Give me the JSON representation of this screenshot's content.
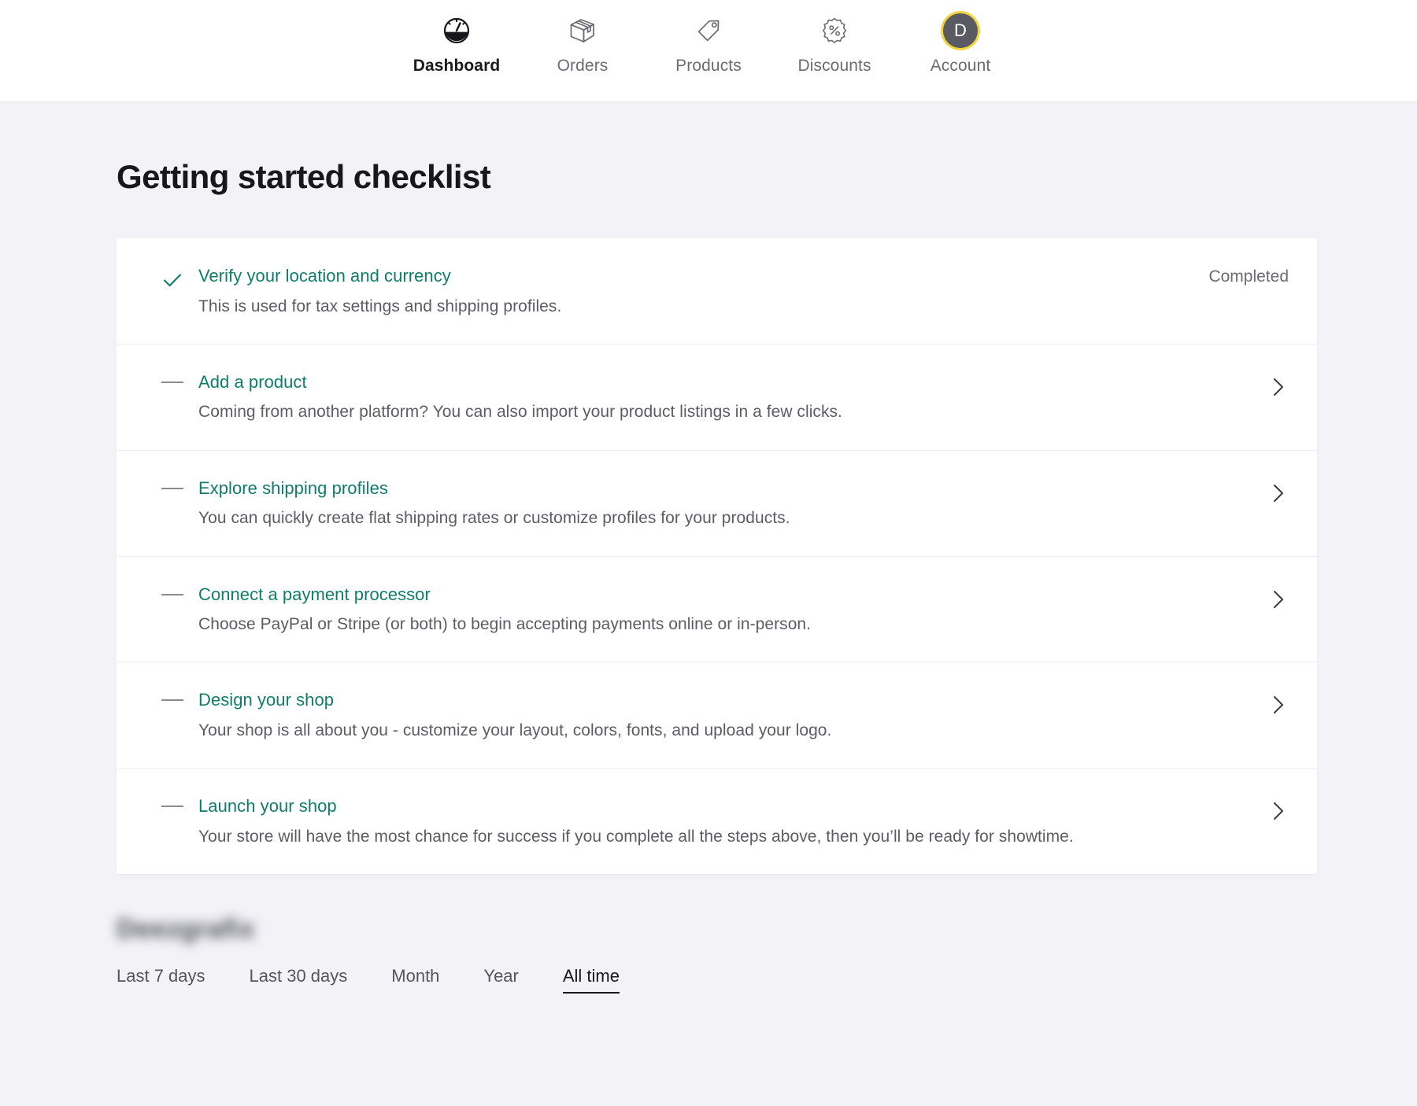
{
  "nav": {
    "items": [
      {
        "label": "Dashboard",
        "icon": "speedometer-icon",
        "active": true
      },
      {
        "label": "Orders",
        "icon": "box-icon",
        "active": false
      },
      {
        "label": "Products",
        "icon": "tag-icon",
        "active": false
      },
      {
        "label": "Discounts",
        "icon": "percent-badge-icon",
        "active": false
      },
      {
        "label": "Account",
        "icon": "avatar-icon",
        "active": false,
        "avatar_initial": "D"
      }
    ]
  },
  "page": {
    "title": "Getting started checklist"
  },
  "checklist": {
    "items": [
      {
        "title": "Verify your location and currency",
        "description": "This is used for tax settings and shipping profiles.",
        "status": "completed",
        "status_label": "Completed",
        "marker": "check-icon",
        "action": "none"
      },
      {
        "title": "Add a product",
        "description": "Coming from another platform? You can also import your product listings in a few clicks.",
        "status": "incomplete",
        "status_label": "",
        "marker": "dash-icon",
        "action": "chevron-right-icon"
      },
      {
        "title": "Explore shipping profiles",
        "description": "You can quickly create flat shipping rates or customize profiles for your products.",
        "status": "incomplete",
        "status_label": "",
        "marker": "dash-icon",
        "action": "chevron-right-icon"
      },
      {
        "title": "Connect a payment processor",
        "description": "Choose PayPal or Stripe (or both) to begin accepting payments online or in-person.",
        "status": "incomplete",
        "status_label": "",
        "marker": "dash-icon",
        "action": "chevron-right-icon"
      },
      {
        "title": "Design your shop",
        "description": "Your shop is all about you - customize your layout, colors, fonts, and upload your logo.",
        "status": "incomplete",
        "status_label": "",
        "marker": "dash-icon",
        "action": "chevron-right-icon"
      },
      {
        "title": "Launch your shop",
        "description": "Your store will have the most chance for success if you complete all the steps above, then you’ll be ready for showtime.",
        "status": "incomplete",
        "status_label": "",
        "marker": "dash-icon",
        "action": "chevron-right-icon"
      }
    ]
  },
  "stats": {
    "shop_name": "Deezgrafix",
    "range_tabs": [
      {
        "label": "Last 7 days",
        "active": false
      },
      {
        "label": "Last 30 days",
        "active": false
      },
      {
        "label": "Month",
        "active": false
      },
      {
        "label": "Year",
        "active": false
      },
      {
        "label": "All time",
        "active": true
      }
    ]
  },
  "colors": {
    "accent_teal": "#0f7d6b",
    "page_background": "#f2f2f7",
    "card_background": "#ffffff",
    "avatar_ring": "#f2d43c",
    "avatar_background": "#5a5a63",
    "text_primary": "#17171c",
    "text_secondary": "#5c5c66"
  }
}
